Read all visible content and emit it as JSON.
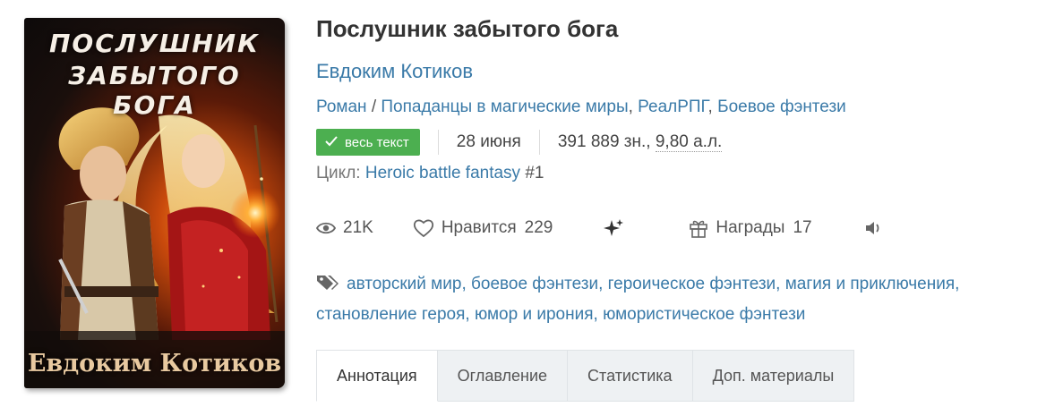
{
  "book": {
    "cover": {
      "title_line1": "ПОСЛУШНИК",
      "title_line2": "ЗАБЫТОГО БОГА",
      "author": "Евдоким Котиков"
    },
    "title": "Послушник забытого бога",
    "author": "Евдоким Котиков",
    "genres": {
      "main": "Роман",
      "separator": "/",
      "list": [
        "Попаданцы в магические миры",
        "РеалРПГ",
        "Боевое фэнтези"
      ]
    },
    "status_badge": "весь текст",
    "date": "28 июня",
    "size_chars": "391 889 зн., ",
    "size_al": "9,80 а.л.",
    "cycle": {
      "label": "Цикл:",
      "name": "Heroic battle fantasy",
      "number": "#1"
    },
    "stats": {
      "views": "21K",
      "likes_label": "Нравится",
      "likes_count": "229",
      "awards_label": "Награды",
      "awards_count": "17"
    },
    "tags": [
      "авторский мир",
      "боевое фэнтези",
      "героическое фэнтези",
      "магия и приключения",
      "становление героя",
      "юмор и ирония",
      "юмористическое фэнтези"
    ],
    "tabs": [
      "Аннотация",
      "Оглавление",
      "Статистика",
      "Доп. материалы"
    ]
  },
  "colors": {
    "link": "#3a7aa8",
    "badge": "#4caf50",
    "tab_bg": "#eef1f3"
  },
  "icons": [
    "check-icon",
    "eye-icon",
    "heart-icon",
    "sparkle-icon",
    "gift-icon",
    "speaker-icon",
    "tag-icon"
  ]
}
